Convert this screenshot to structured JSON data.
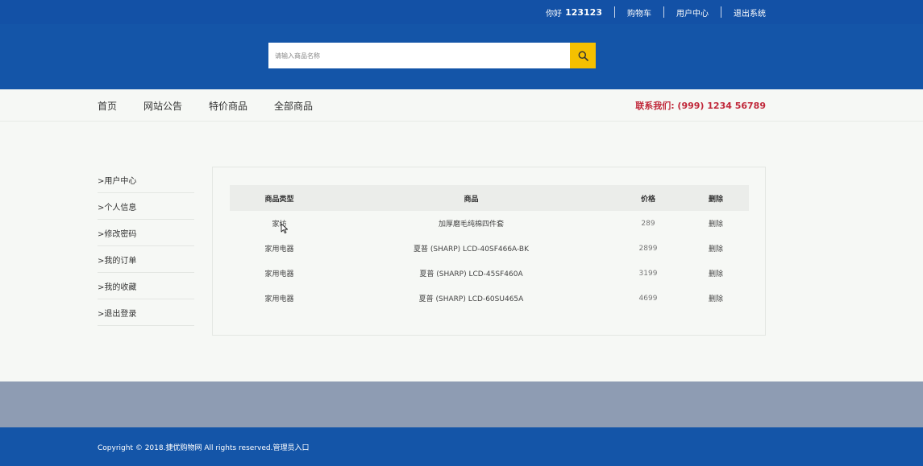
{
  "topbar": {
    "greeting_prefix": "你好",
    "username": "123123",
    "links": [
      "购物车",
      "用户中心",
      "退出系统"
    ]
  },
  "search": {
    "placeholder": "请输入商品名称",
    "icon": "search-icon"
  },
  "nav": {
    "items": [
      "首页",
      "网站公告",
      "特价商品",
      "全部商品"
    ],
    "contact": "联系我们: (999) 1234 56789"
  },
  "sidebar": {
    "items": [
      ">用户中心",
      ">个人信息",
      ">修改密码",
      ">我的订单",
      ">我的收藏",
      ">退出登录"
    ]
  },
  "table": {
    "headers": [
      "商品类型",
      "商品",
      "价格",
      "删除"
    ],
    "rows": [
      {
        "type": "家纺",
        "item": "加厚磨毛纯棉四件套",
        "price": "289",
        "action": "删除"
      },
      {
        "type": "家用电器",
        "item": "夏普 (SHARP) LCD-40SF466A-BK",
        "price": "2899",
        "action": "删除"
      },
      {
        "type": "家用电器",
        "item": "夏普 (SHARP) LCD-45SF460A",
        "price": "3199",
        "action": "删除"
      },
      {
        "type": "家用电器",
        "item": "夏普 (SHARP) LCD-60SU465A",
        "price": "4699",
        "action": "删除"
      }
    ]
  },
  "footer": {
    "copyright": "Copyright © 2018.捷优购物网 All rights reserved.",
    "admin_link": "管理员入口"
  },
  "colors": {
    "primary_blue": "#1455a8",
    "accent_yellow": "#f5c000",
    "contact_red": "#c0283a",
    "band_gray": "#8e9cb3"
  }
}
